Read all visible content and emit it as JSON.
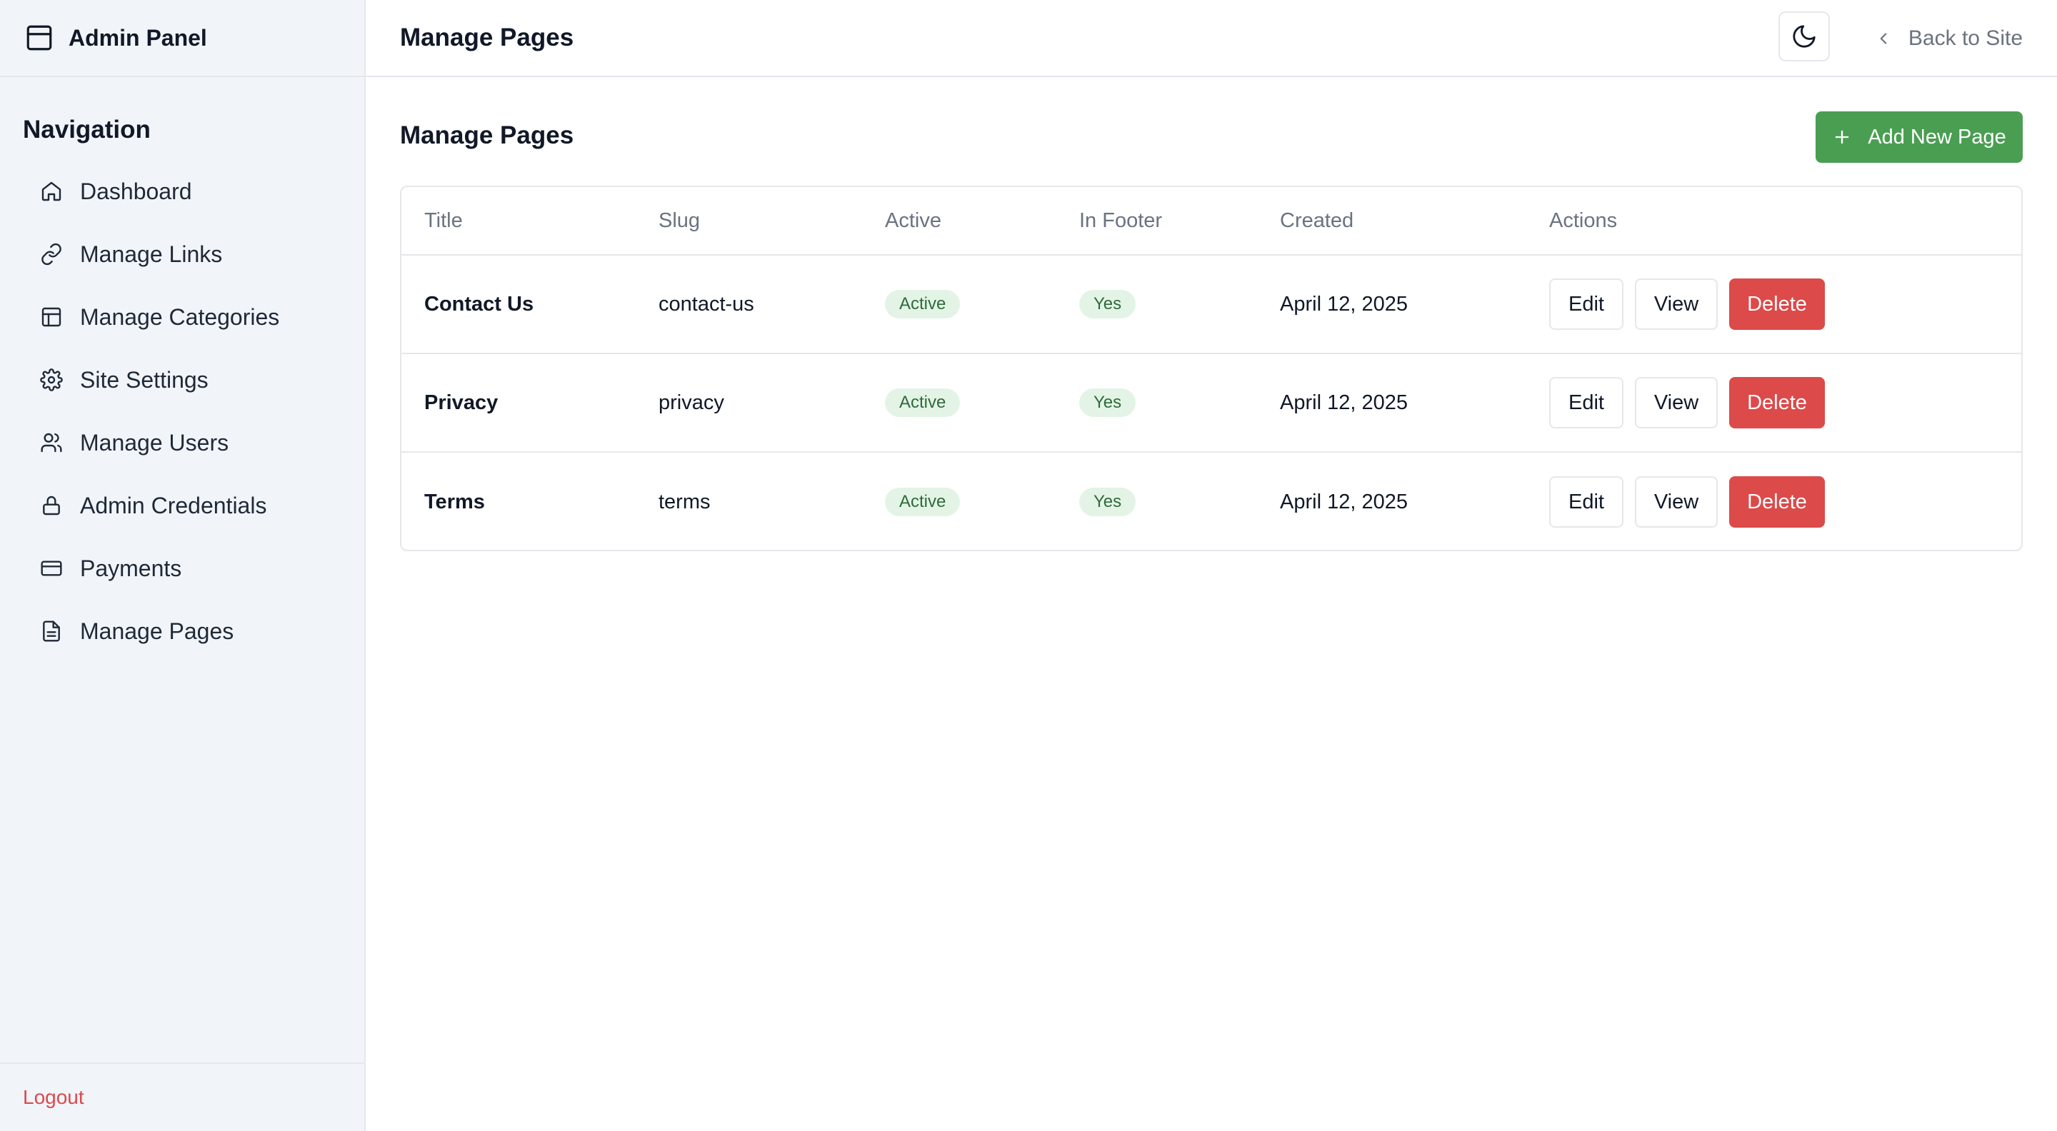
{
  "sidebar": {
    "brand": "Admin Panel",
    "nav_title": "Navigation",
    "items": [
      {
        "label": "Dashboard",
        "icon": "home-icon"
      },
      {
        "label": "Manage Links",
        "icon": "link-icon"
      },
      {
        "label": "Manage Categories",
        "icon": "layout-icon"
      },
      {
        "label": "Site Settings",
        "icon": "gear-icon"
      },
      {
        "label": "Manage Users",
        "icon": "users-icon"
      },
      {
        "label": "Admin Credentials",
        "icon": "lock-icon"
      },
      {
        "label": "Payments",
        "icon": "credit-card-icon"
      },
      {
        "label": "Manage Pages",
        "icon": "file-icon"
      }
    ],
    "logout": "Logout"
  },
  "topbar": {
    "title": "Manage Pages",
    "back_label": "Back to Site"
  },
  "main": {
    "section_title": "Manage Pages",
    "add_button": "Add New Page",
    "table": {
      "headers": [
        "Title",
        "Slug",
        "Active",
        "In Footer",
        "Created",
        "Actions"
      ],
      "rows": [
        {
          "title": "Contact Us",
          "slug": "contact-us",
          "active": "Active",
          "in_footer": "Yes",
          "created": "April 12, 2025"
        },
        {
          "title": "Privacy",
          "slug": "privacy",
          "active": "Active",
          "in_footer": "Yes",
          "created": "April 12, 2025"
        },
        {
          "title": "Terms",
          "slug": "terms",
          "active": "Active",
          "in_footer": "Yes",
          "created": "April 12, 2025"
        }
      ],
      "actions": {
        "edit": "Edit",
        "view": "View",
        "delete": "Delete"
      }
    }
  },
  "colors": {
    "sidebar_bg": "#f1f5fa",
    "primary_green": "#4a9e52",
    "danger_red": "#dc4a4a",
    "badge_bg": "#e3f4e6",
    "badge_text": "#2f6b3a"
  }
}
